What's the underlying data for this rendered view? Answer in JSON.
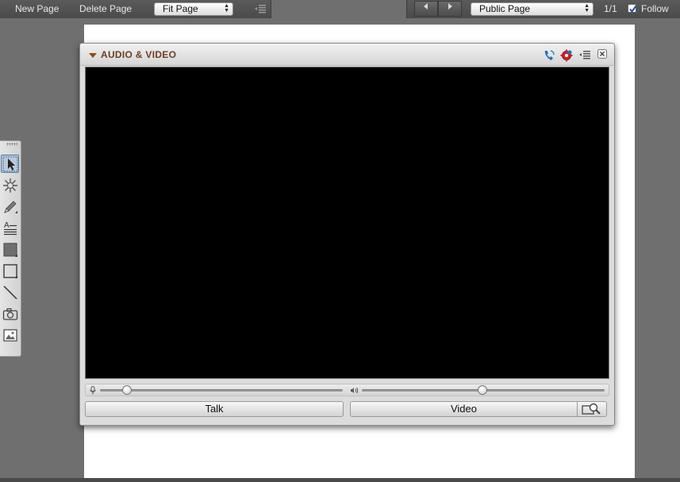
{
  "toolbar": {
    "new_page": "New Page",
    "delete_page": "Delete Page",
    "zoom_select": "Fit Page"
  },
  "page_nav": {
    "prev_icon": "triangle-left-icon",
    "next_icon": "triangle-right-icon",
    "view_select": "Public Page",
    "page_count": "1/1",
    "follow_label": "Follow",
    "follow_checked": true
  },
  "tools": [
    {
      "name": "select-tool",
      "icon": "arrow-cursor-icon",
      "active": true
    },
    {
      "name": "laser-pointer-tool",
      "icon": "sparkle-icon"
    },
    {
      "name": "pencil-tool",
      "icon": "pencil-icon"
    },
    {
      "name": "text-tool",
      "icon": "text-icon"
    },
    {
      "name": "filled-shape-tool",
      "icon": "filled-square-icon"
    },
    {
      "name": "rectangle-tool",
      "icon": "rectangle-icon"
    },
    {
      "name": "line-tool",
      "icon": "line-icon"
    },
    {
      "name": "camera-tool",
      "icon": "camera-icon"
    },
    {
      "name": "image-tool",
      "icon": "image-icon"
    }
  ],
  "pod": {
    "title": "AUDIO & VIDEO",
    "header_icons": [
      "phone-icon",
      "settings-icon",
      "menu-icon",
      "close-icon"
    ],
    "mic_level": 0.08,
    "speaker_level": 0.5,
    "talk_label": "Talk",
    "video_label": "Video",
    "preview_icon": "camera-preview-icon"
  },
  "colors": {
    "background": "#6f6f6f",
    "title": "#6b3e28",
    "video": "#000000"
  }
}
